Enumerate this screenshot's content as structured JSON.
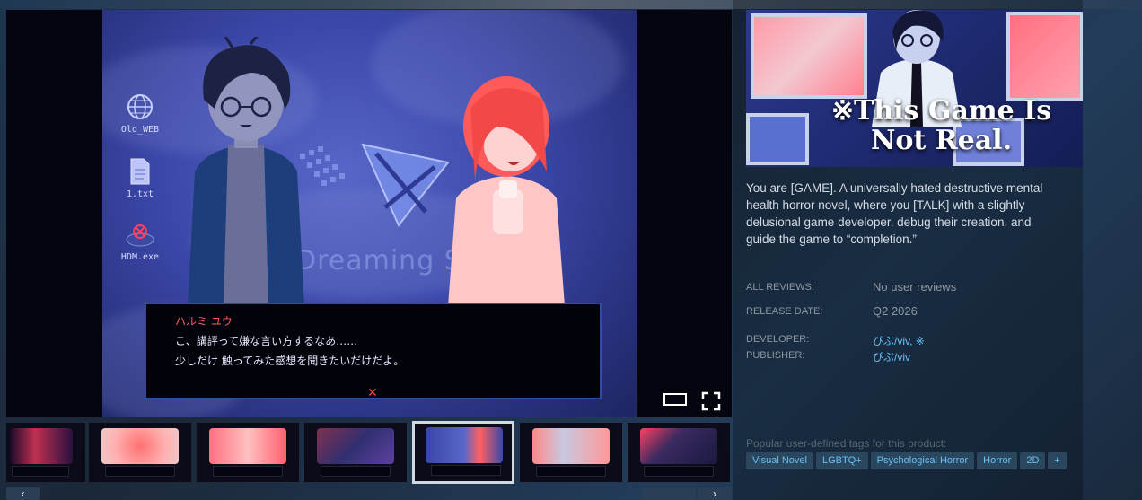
{
  "viewer": {
    "desktop_icons": [
      {
        "label": "Old_WEB",
        "icon": "globe-icon"
      },
      {
        "label": "1.txt",
        "icon": "file-icon"
      },
      {
        "label": "HDM.exe",
        "icon": "virus-icon"
      }
    ],
    "logo_text": "Dreaming S",
    "dialogue": {
      "speaker": "ハルミ ユウ",
      "line1": "こ、講評って嫌な言い方するなあ……",
      "line2": "少しだけ 触ってみた感想を聞きたいだけだよ。",
      "close_glyph": "✕"
    }
  },
  "thumbnails": [
    {
      "color": "#c03050"
    },
    {
      "color": "#f08080"
    },
    {
      "color": "#ff7080"
    },
    {
      "color": "#303070"
    },
    {
      "color": "#3b47a8"
    },
    {
      "color": "#ff8888"
    },
    {
      "color": "#3a2a60"
    }
  ],
  "game": {
    "capsule_title_line1": "※This Game Is",
    "capsule_title_line2": "Not Real.",
    "description": "You are [GAME]. A universally hated destructive mental health horror novel, where you [TALK] with a slightly delusional game developer, debug their creation, and guide the game to “completion.”",
    "reviews_label": "ALL REVIEWS:",
    "reviews_value": "No user reviews",
    "release_label": "RELEASE DATE:",
    "release_value": "Q2 2026",
    "developer_label": "DEVELOPER:",
    "developer_value": "ぴぶ/viv, ※",
    "publisher_label": "PUBLISHER:",
    "publisher_value": "ぴぶ/viv",
    "tags_title": "Popular user-defined tags for this product:",
    "tags": [
      "Visual Novel",
      "LGBTQ+",
      "Psychological Horror",
      "Horror",
      "2D",
      "+"
    ]
  },
  "colors": {
    "link": "#66c0f4",
    "tag_bg": "#2a475e"
  }
}
